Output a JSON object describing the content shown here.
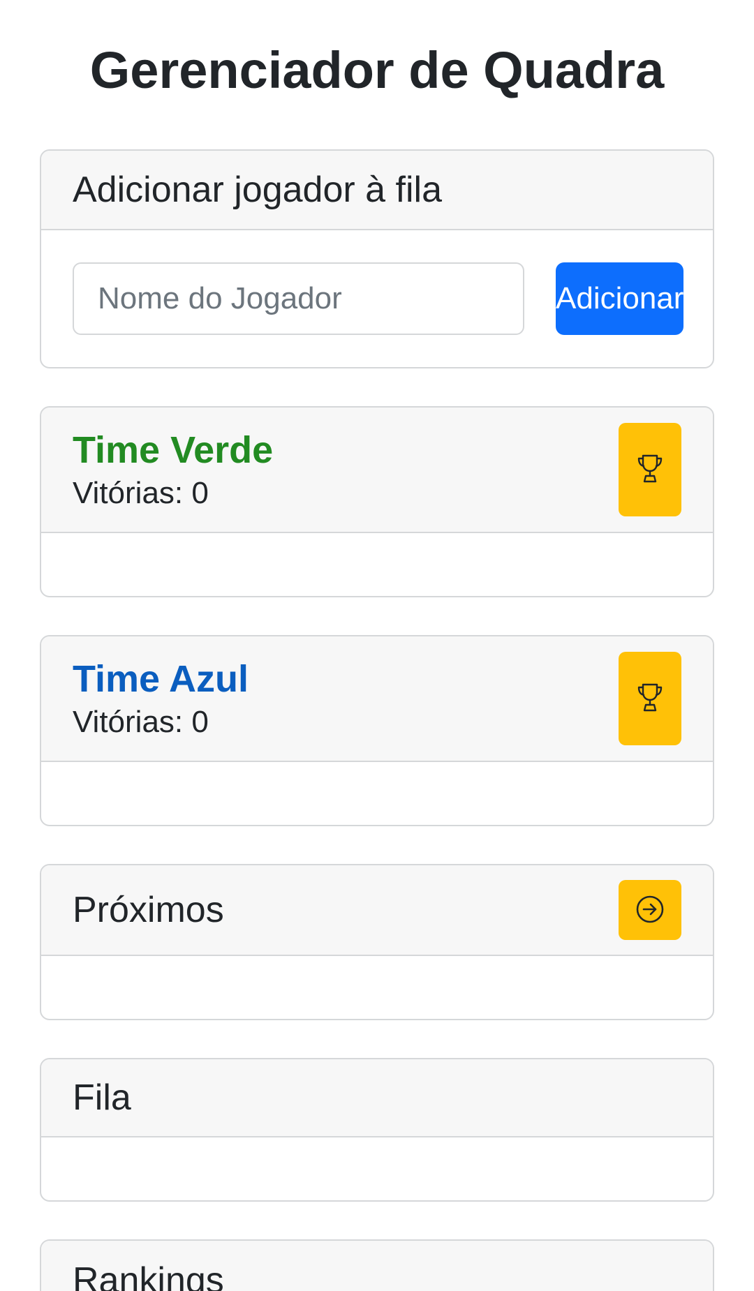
{
  "app": {
    "title": "Gerenciador de Quadra"
  },
  "add_player": {
    "title": "Adicionar jogador à fila",
    "input_placeholder": "Nome do Jogador",
    "input_value": "",
    "button_label": "Adicionar"
  },
  "teams": [
    {
      "name": "Time Verde",
      "wins_label": "Vitórias: 0",
      "color": "#228b22",
      "action_icon": "trophy-icon"
    },
    {
      "name": "Time Azul",
      "wins_label": "Vitórias: 0",
      "color": "#0b5ebf",
      "action_icon": "trophy-icon"
    }
  ],
  "next_section": {
    "title": "Próximos",
    "action_icon": "arrow-right-circle-icon"
  },
  "queue_section": {
    "title": "Fila"
  },
  "rankings_section": {
    "title": "Rankings"
  },
  "colors": {
    "primary": "#0d6efd",
    "warning": "#ffc107",
    "header_bg": "#f7f7f7",
    "border": "#d5d7d9"
  }
}
